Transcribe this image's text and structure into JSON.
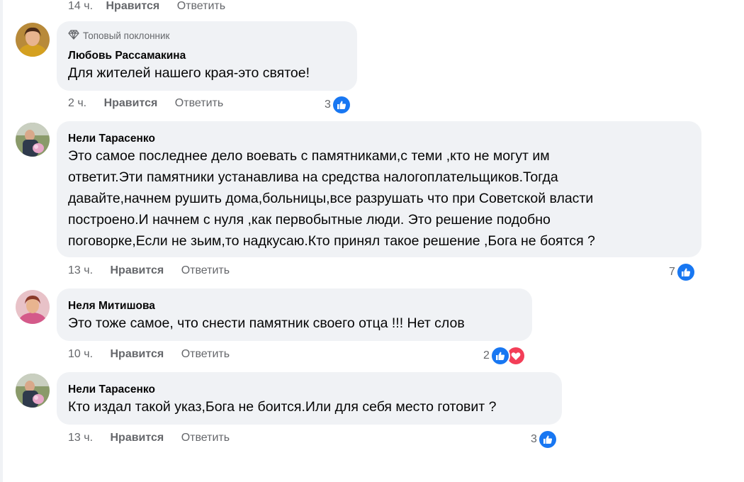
{
  "top_meta": {
    "time": "14 ч.",
    "like": "Нравится",
    "reply": "Ответить"
  },
  "colors": {
    "like_blue": "#1877f2",
    "love_red": "#f33e58",
    "bubble_bg": "#f0f2f5",
    "meta_gray": "#65676b"
  },
  "comments": [
    {
      "badge": "Топовый поклонник",
      "badge_icon": "diamond-icon",
      "author": "Любовь Рассамакина",
      "lines": [
        "Для жителей нашего края-это святое!"
      ],
      "time": "2 ч.",
      "like": "Нравится",
      "reply": "Ответить",
      "reaction_count": "3",
      "reactions": [
        "like"
      ]
    },
    {
      "author": "Нели Тарасенко",
      "lines": [
        "Это самое последнее дело воевать с памятниками,с теми ,кто не могут им",
        "ответит.Эти памятники устанавлива на средства налогоплательщиков.Тогда",
        "давайте,начнем рушить дома,больницы,все разрушать что при Советской власти",
        "построено.И начнем с нуля ,как первобытные люди. Это решение подобно",
        "поговорке,Если не зьим,то надкусаю.Кто принял такое решение ,Бога не боятся ?"
      ],
      "time": "13 ч.",
      "like": "Нравится",
      "reply": "Ответить",
      "reaction_count": "7",
      "reactions": [
        "like"
      ]
    },
    {
      "author": "Неля Митишова",
      "lines": [
        "Это тоже самое, что снести памятник своего отца !!! Нет слов"
      ],
      "time": "10 ч.",
      "like": "Нравится",
      "reply": "Ответить",
      "reaction_count": "2",
      "reactions": [
        "like",
        "love"
      ]
    },
    {
      "author": "Нели Тарасенко",
      "lines": [
        "Кто издал такой указ,Бога не боится.Или для себя место готовит ?"
      ],
      "time": "13 ч.",
      "like": "Нравится",
      "reply": "Ответить",
      "reaction_count": "3",
      "reactions": [
        "like"
      ]
    }
  ]
}
